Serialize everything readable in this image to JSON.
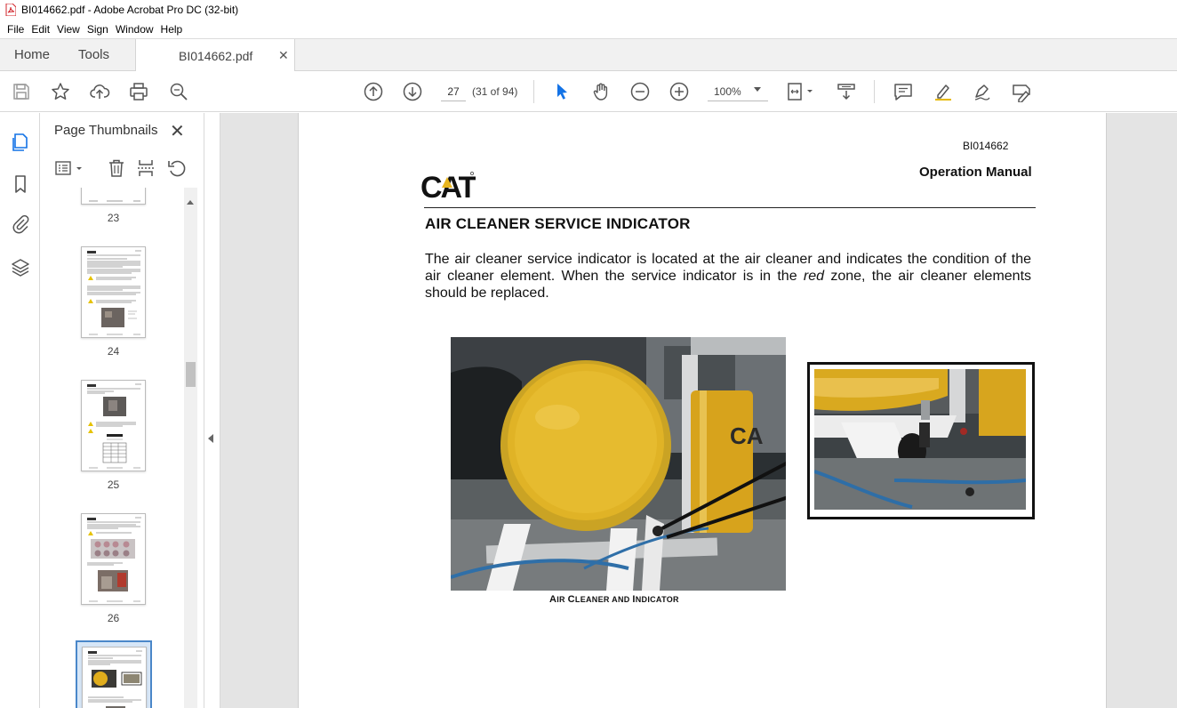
{
  "window": {
    "title": "BI014662.pdf - Adobe Acrobat Pro DC (32-bit)"
  },
  "menu": {
    "items": [
      "File",
      "Edit",
      "View",
      "Sign",
      "Window",
      "Help"
    ]
  },
  "tabs": {
    "home": "Home",
    "tools": "Tools",
    "document": "BI014662.pdf",
    "close_glyph": "✕"
  },
  "toolbar": {
    "page_number": "27",
    "page_count": "(31 of 94)",
    "zoom": "100%"
  },
  "thumbnails_panel": {
    "title": "Page Thumbnails",
    "close_glyph": "✕",
    "pages": [
      {
        "label": "23"
      },
      {
        "label": "24"
      },
      {
        "label": "25"
      },
      {
        "label": "26"
      }
    ]
  },
  "document": {
    "doc_number": "BI014662",
    "manual_title": "Operation Manual",
    "logo_text": "CAT",
    "section_title": "AIR CLEANER SERVICE INDICATOR",
    "paragraph_before": "The air cleaner service indicator is located at the air cleaner and indicates the condition of the air cleaner element. When the service indicator is in the",
    "paragraph_emphasis": "red",
    "paragraph_after": "zone, the air cleaner elements should be replaced.",
    "caption_parts": [
      "A",
      "IR ",
      "C",
      "LEANER AND ",
      "I",
      "NDICATOR"
    ]
  },
  "colors": {
    "cat_yellow": "#e8b51e",
    "selection_blue": "#4a87c9",
    "pointer_blue": "#1473e6"
  }
}
